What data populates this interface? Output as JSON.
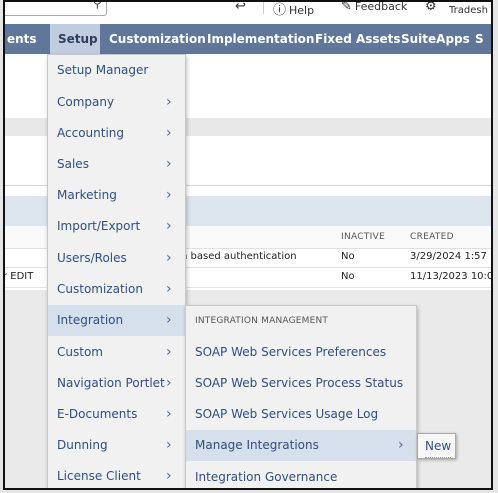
{
  "utility_bar": {
    "help_label": "Help",
    "feedback_label": "Feedback",
    "account_label": "Tradesh"
  },
  "nav": {
    "items": [
      {
        "label": "ents"
      },
      {
        "label": "Setup"
      },
      {
        "label": "Customization"
      },
      {
        "label": "Implementation"
      },
      {
        "label": "Fixed Assets"
      },
      {
        "label": "SuiteApps"
      },
      {
        "label": "S"
      }
    ]
  },
  "background_table": {
    "columns": [
      "INACTIVE",
      "CREATED"
    ],
    "rows": [
      {
        "name": "n based authentication",
        "inactive": "No",
        "created": "3/29/2024 1:57"
      },
      {
        "name": "r EDIT",
        "inactive": "No",
        "created": "11/13/2023 10:0"
      }
    ]
  },
  "setup_menu": {
    "items": [
      {
        "label": "Setup Manager"
      },
      {
        "label": "Company"
      },
      {
        "label": "Accounting"
      },
      {
        "label": "Sales"
      },
      {
        "label": "Marketing"
      },
      {
        "label": "Import/Export"
      },
      {
        "label": "Users/Roles"
      },
      {
        "label": "Customization"
      },
      {
        "label": "Integration"
      },
      {
        "label": "Custom"
      },
      {
        "label": "Navigation Portlet"
      },
      {
        "label": "E-Documents"
      },
      {
        "label": "Dunning"
      },
      {
        "label": "License Client"
      }
    ]
  },
  "integration_submenu": {
    "header": "INTEGRATION MANAGEMENT",
    "items": [
      {
        "label": "SOAP Web Services Preferences"
      },
      {
        "label": "SOAP Web Services Process Status"
      },
      {
        "label": "SOAP Web Services Usage Log"
      },
      {
        "label": "Manage Integrations"
      },
      {
        "label": "Integration Governance"
      }
    ]
  },
  "manage_integrations_submenu": {
    "items": [
      {
        "label": "New"
      }
    ]
  },
  "icons": {
    "search": "search-icon",
    "chevron": "chevron-right-icon"
  }
}
